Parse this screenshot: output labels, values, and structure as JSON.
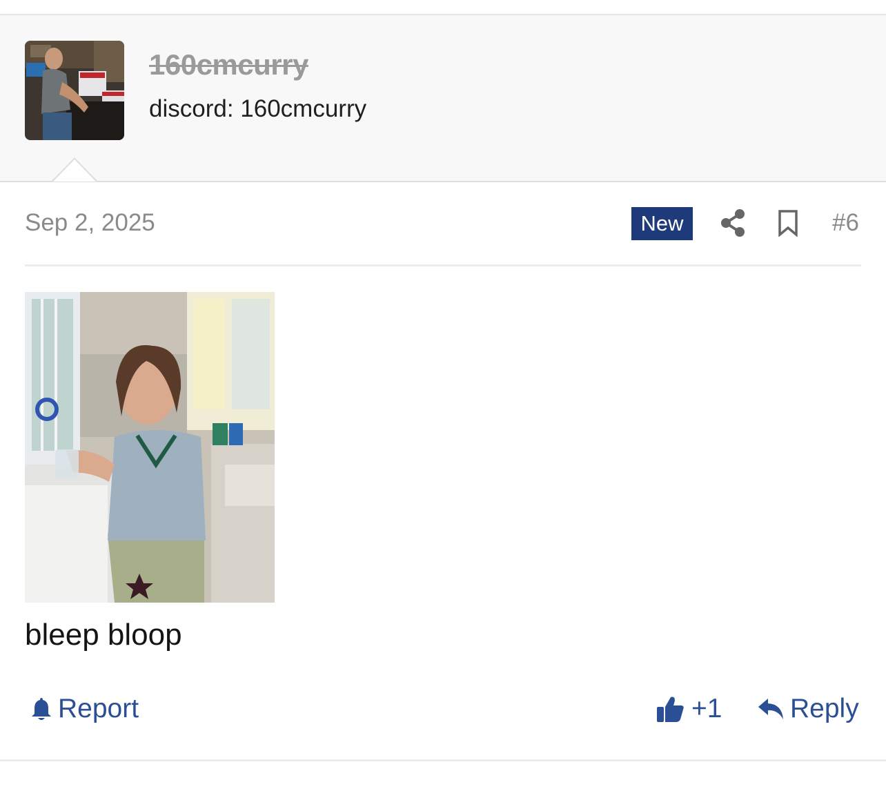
{
  "user": {
    "username": "160cmcurry",
    "title": "discord: 160cmcurry"
  },
  "post": {
    "date": "Sep 2, 2025",
    "badge": "New",
    "number": "#6",
    "body": "bleep bloop"
  },
  "actions": {
    "report": "Report",
    "like_count": "+1",
    "reply": "Reply"
  },
  "colors": {
    "badge_bg": "#1f3a7a",
    "action_link": "#2b4f94",
    "muted_text": "#8a8a8a"
  },
  "icons": [
    "share-icon",
    "bookmark-icon",
    "bell-icon",
    "thumbs-up-icon",
    "reply-arrow-icon"
  ]
}
